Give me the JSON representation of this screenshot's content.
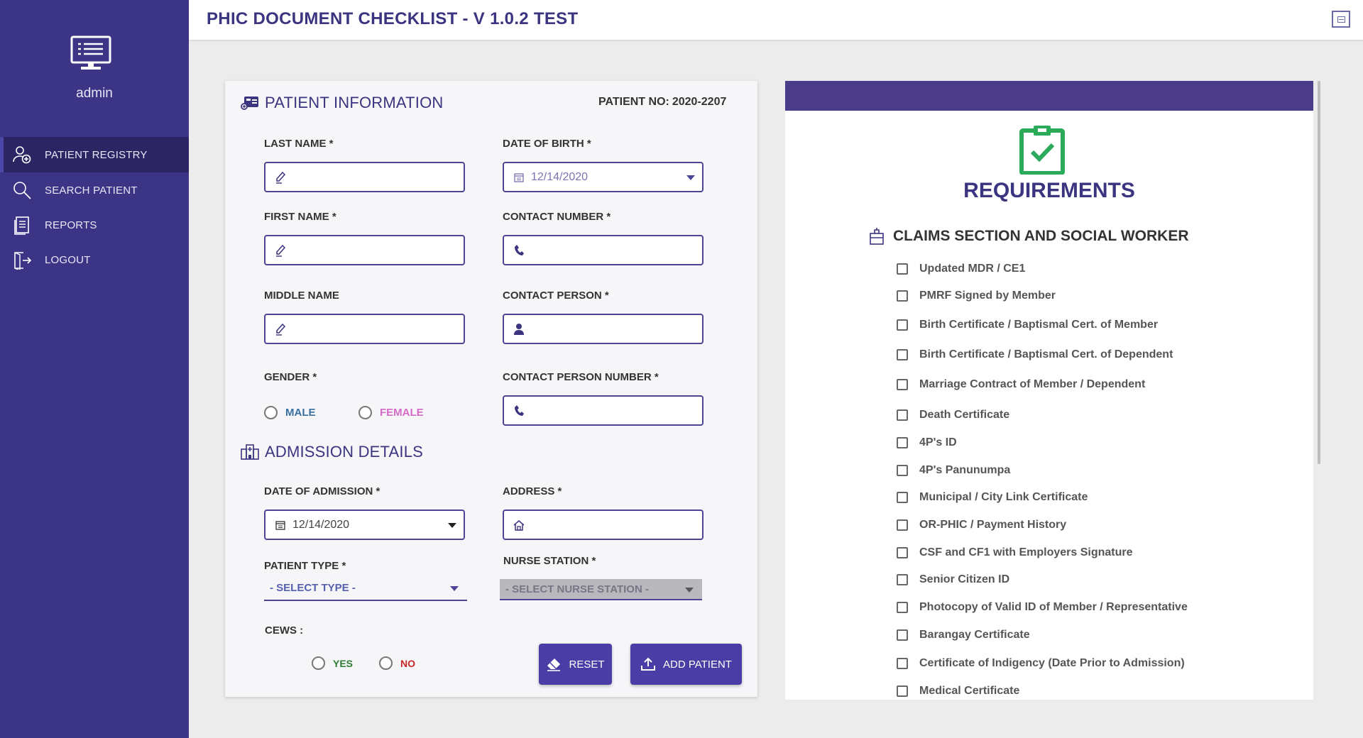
{
  "sidebar": {
    "user": "admin",
    "items": [
      {
        "label": "PATIENT REGISTRY",
        "icon": "user-add-icon",
        "active": true
      },
      {
        "label": "SEARCH PATIENT",
        "icon": "search-icon",
        "active": false
      },
      {
        "label": "REPORTS",
        "icon": "document-icon",
        "active": false
      },
      {
        "label": "LOGOUT",
        "icon": "logout-icon",
        "active": false
      }
    ]
  },
  "header": {
    "title": "PHIC DOCUMENT CHECKLIST - V 1.0.2 TEST"
  },
  "patient_info": {
    "heading": "PATIENT INFORMATION",
    "patient_no_label": "PATIENT NO:",
    "patient_no": "2020-2207",
    "last_name_label": "LAST NAME *",
    "last_name": "",
    "first_name_label": "FIRST NAME *",
    "first_name": "",
    "middle_name_label": "MIDDLE NAME",
    "middle_name": "",
    "gender_label": "GENDER *",
    "gender_male": "MALE",
    "gender_female": "FEMALE",
    "dob_label": "DATE OF BIRTH *",
    "dob": "12/14/2020",
    "contact_number_label": "CONTACT NUMBER *",
    "contact_number": "",
    "contact_person_label": "CONTACT PERSON *",
    "contact_person": "",
    "contact_person_number_label": "CONTACT PERSON NUMBER *",
    "contact_person_number": ""
  },
  "admission": {
    "heading": "ADMISSION DETAILS",
    "date_label": "DATE OF ADMISSION *",
    "date": "12/14/2020",
    "address_label": "ADDRESS *",
    "address": "",
    "patient_type_label": "PATIENT TYPE *",
    "patient_type": "- SELECT TYPE -",
    "nurse_station_label": "NURSE STATION *",
    "nurse_station": "- SELECT NURSE STATION -",
    "cews_label": "CEWS :",
    "cews_yes": "YES",
    "cews_no": "NO"
  },
  "buttons": {
    "reset": "RESET",
    "add_patient": "ADD PATIENT"
  },
  "requirements": {
    "title": "REQUIREMENTS",
    "section": "CLAIMS SECTION AND SOCIAL WORKER",
    "items": [
      "Updated MDR / CE1",
      "PMRF Signed by Member",
      "Birth Certificate / Baptismal Cert. of Member",
      "Birth Certificate / Baptismal Cert. of Dependent",
      "Marriage Contract of Member / Dependent",
      "Death Certificate",
      "4P's ID",
      "4P's Panunumpa",
      "Municipal / City Link Certificate",
      "OR-PHIC / Payment History",
      "CSF and CF1 with Employers Signature",
      "Senior Citizen ID",
      "Photocopy of Valid ID of Member / Representative",
      "Barangay Certificate",
      "Certificate of Indigency (Date Prior to Admission)",
      "Medical Certificate"
    ]
  },
  "colors": {
    "sidebar": "#3c3586",
    "accent": "#4c4495",
    "male": "#3a6fa0",
    "female": "#d46ac8",
    "yes": "#2e7d32",
    "no": "#c62828",
    "clipboard": "#2bab5a"
  }
}
